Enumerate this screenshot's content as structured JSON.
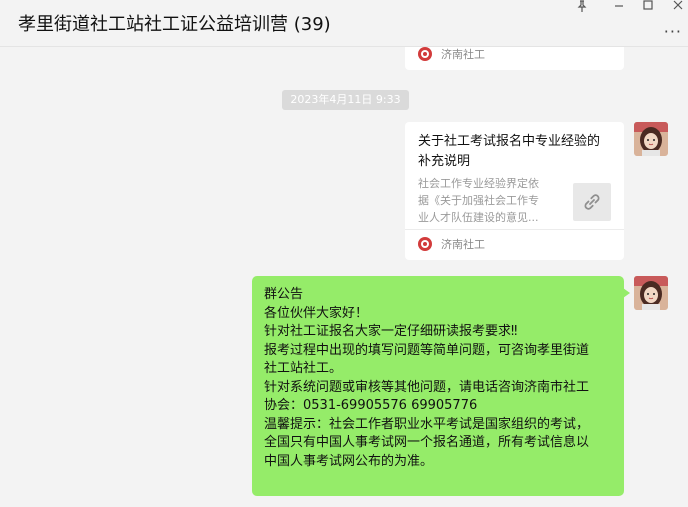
{
  "window": {
    "title": "孝里街道社工站社工证公益培训营 (39)",
    "pin_icon": "pin-icon",
    "minimize_icon": "minimize-icon",
    "maximize_icon": "maximize-icon",
    "close_icon": "close-icon",
    "more_label": "···"
  },
  "colors": {
    "background": "#f3f3f3",
    "bubble": "#95ec69",
    "timestamp_bg": "#dadada",
    "logo_red": "#d23b3b"
  },
  "chat": {
    "prev_card": {
      "source": "济南社工"
    },
    "timestamp": "2023年4月11日 9:33",
    "link_card": {
      "title_line1": "关于社工考试报名中专业经验的",
      "title_line2": "补充说明",
      "desc_line1": "社会工作专业经验界定依",
      "desc_line2": "据《关于加强社会工作专",
      "desc_line3": "业人才队伍建设的意见...",
      "thumb_icon": "link-icon",
      "source": "济南社工"
    },
    "notice": {
      "lines": [
        "群公告",
        "各位伙伴大家好！",
        "针对社工证报名大家一定仔细研读报考要求‼",
        "报考过程中出现的填写问题等简单问题，可咨询孝里街道",
        "社工站社工。",
        "针对系统问题或审核等其他问题，请电话咨询济南市社工",
        "协会：0531-69905576  69905776",
        "温馨提示：社会工作者职业水平考试是国家组织的考试，",
        "全国只有中国人事考试网一个报名通道，所有考试信息以",
        "中国人事考试网公布的为准。"
      ]
    }
  }
}
